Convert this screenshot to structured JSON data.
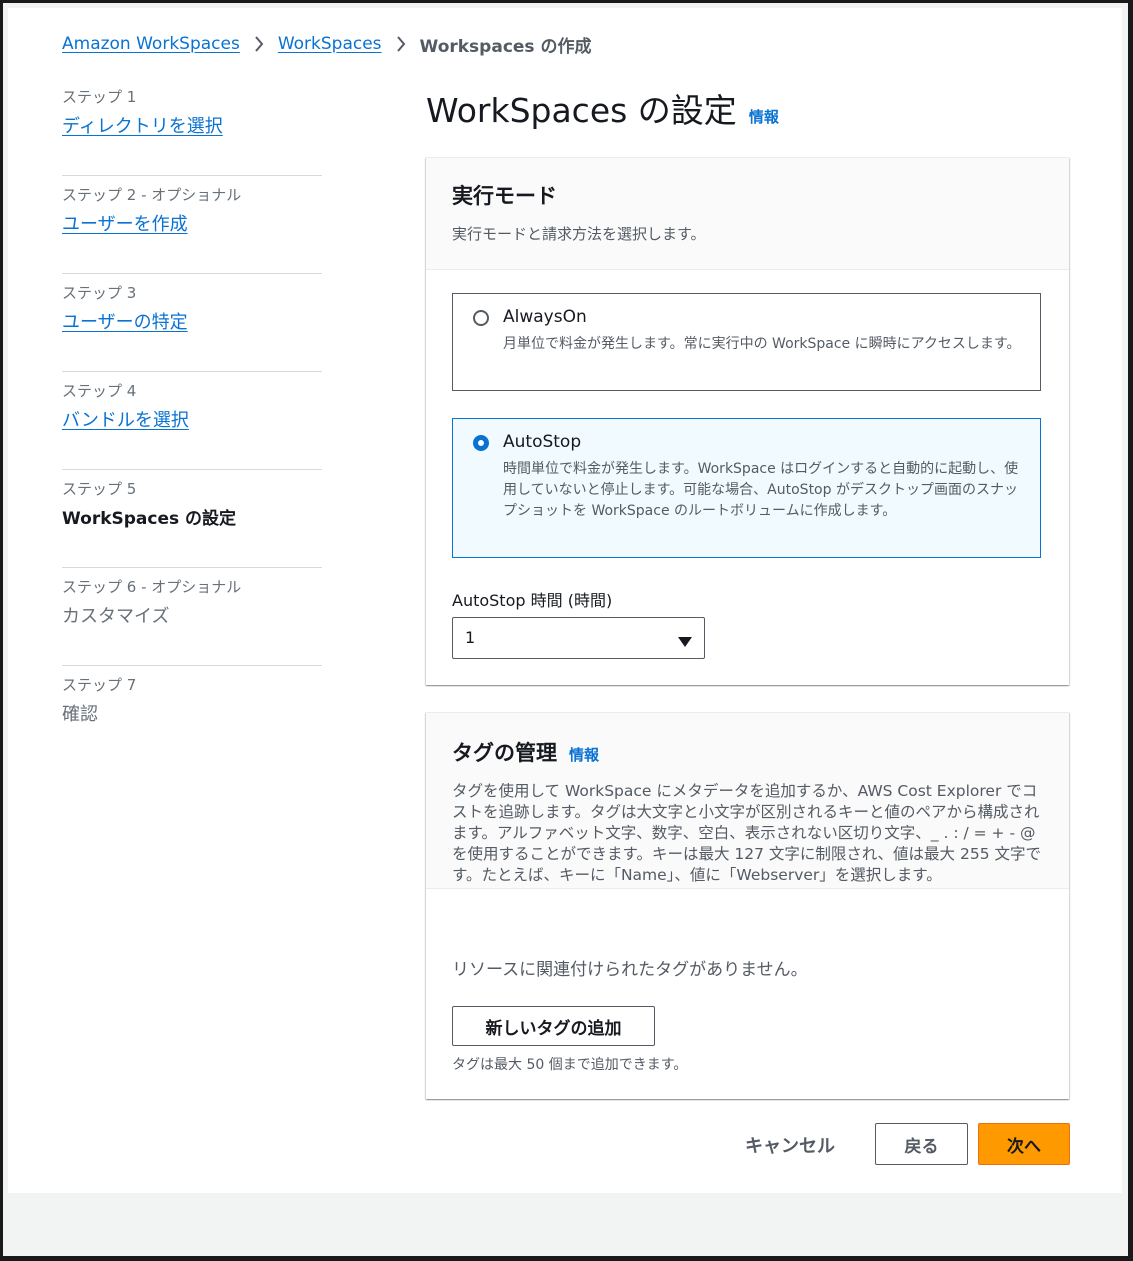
{
  "breadcrumb": {
    "items": [
      "Amazon WorkSpaces",
      "WorkSpaces"
    ],
    "current": "Workspaces の作成"
  },
  "steps": [
    {
      "label": "ステップ 1",
      "title": "ディレクトリを選択"
    },
    {
      "label": "ステップ 2 - オプショナル",
      "title": "ユーザーを作成"
    },
    {
      "label": "ステップ 3",
      "title": "ユーザーの特定"
    },
    {
      "label": "ステップ 4",
      "title": "バンドルを選択"
    },
    {
      "label": "ステップ 5",
      "title": "WorkSpaces の設定"
    },
    {
      "label": "ステップ 6 - オプショナル",
      "title": "カスタマイズ"
    },
    {
      "label": "ステップ 7",
      "title": "確認"
    }
  ],
  "main": {
    "title": "WorkSpaces の設定",
    "info": "情報"
  },
  "run_mode": {
    "title": "実行モード",
    "description": "実行モードと請求方法を選択します。",
    "options": [
      {
        "title": "AlwaysOn",
        "description": "月単位で料金が発生します。常に実行中の WorkSpace に瞬時にアクセスします。",
        "selected": false
      },
      {
        "title": "AutoStop",
        "description": "時間単位で料金が発生します。WorkSpace はログインすると自動的に起動し、使用していないと停止します。可能な場合、AutoStop がデスクトップ画面のスナップショットを WorkSpace のルートボリュームに作成します。",
        "selected": true
      }
    ],
    "autostop_label": "AutoStop 時間 (時間)",
    "autostop_value": "1"
  },
  "tags": {
    "title": "タグの管理",
    "info": "情報",
    "description": "タグを使用して WorkSpace にメタデータを追加するか、AWS Cost Explorer でコストを追跡します。タグは大文字と小文字が区別されるキーと値のペアから構成されます。アルファベット文字、数字、空白、表示されない区切り文字、_ . : / = + - @ を使用することができます。キーは最大 127 文字に制限され、値は最大 255 文字です。たとえば、キーに「Name」、値に「Webserver」を選択します。",
    "empty": "リソースに関連付けられたタグがありません。",
    "add_button": "新しいタグの追加",
    "limit": "タグは最大 50 個まで追加できます。"
  },
  "footer": {
    "cancel": "キャンセル",
    "back": "戻る",
    "next": "次へ"
  },
  "colors": {
    "link": "#0972d3",
    "primary_button": "#ff9900",
    "selected_tile_bg": "#f1faff"
  }
}
